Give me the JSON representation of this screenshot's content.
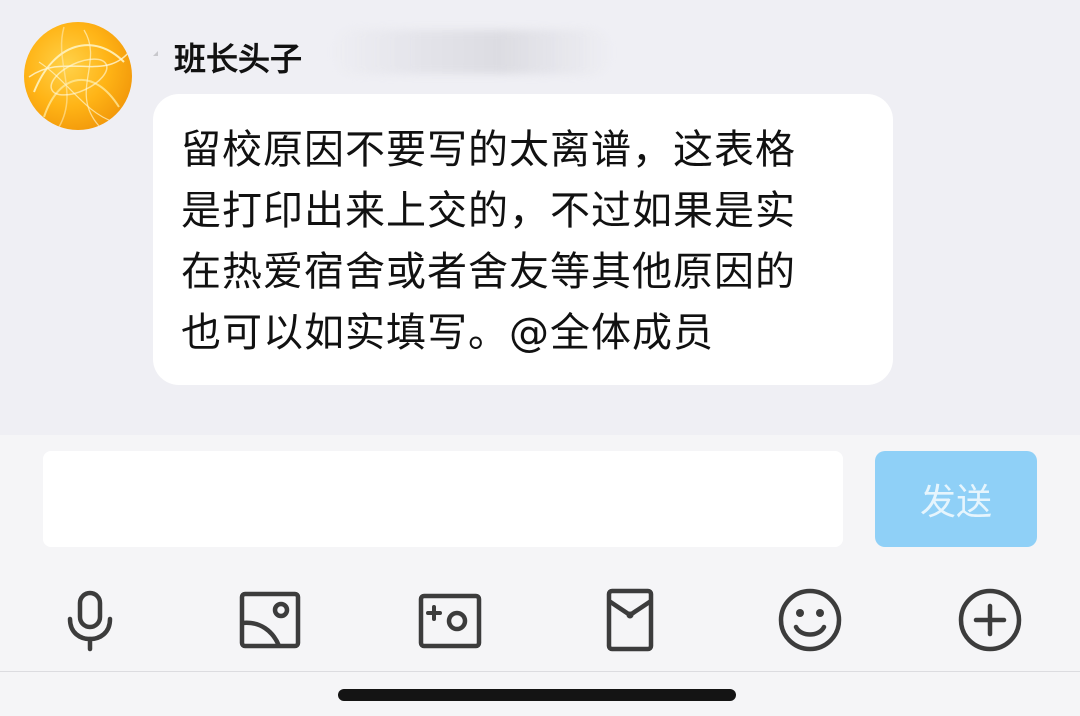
{
  "message": {
    "sender_name": "班长头子",
    "text": "留校原因不要写的太离谱，这表格\n是打印出来上交的，不过如果是实\n在热爱宿舍或者舍友等其他原因的\n也可以如实填写。@全体成员"
  },
  "composer": {
    "input_value": "",
    "send_label": "发送"
  },
  "toolbar": {
    "items": [
      {
        "icon": "microphone-icon"
      },
      {
        "icon": "image-icon"
      },
      {
        "icon": "camera-icon"
      },
      {
        "icon": "red-packet-icon"
      },
      {
        "icon": "emoji-icon"
      },
      {
        "icon": "plus-icon"
      }
    ]
  },
  "colors": {
    "chat_background": "#efeff4",
    "bubble": "#ffffff",
    "send_button": "#8fd0f7",
    "icon_stroke": "#3c3c3c"
  }
}
